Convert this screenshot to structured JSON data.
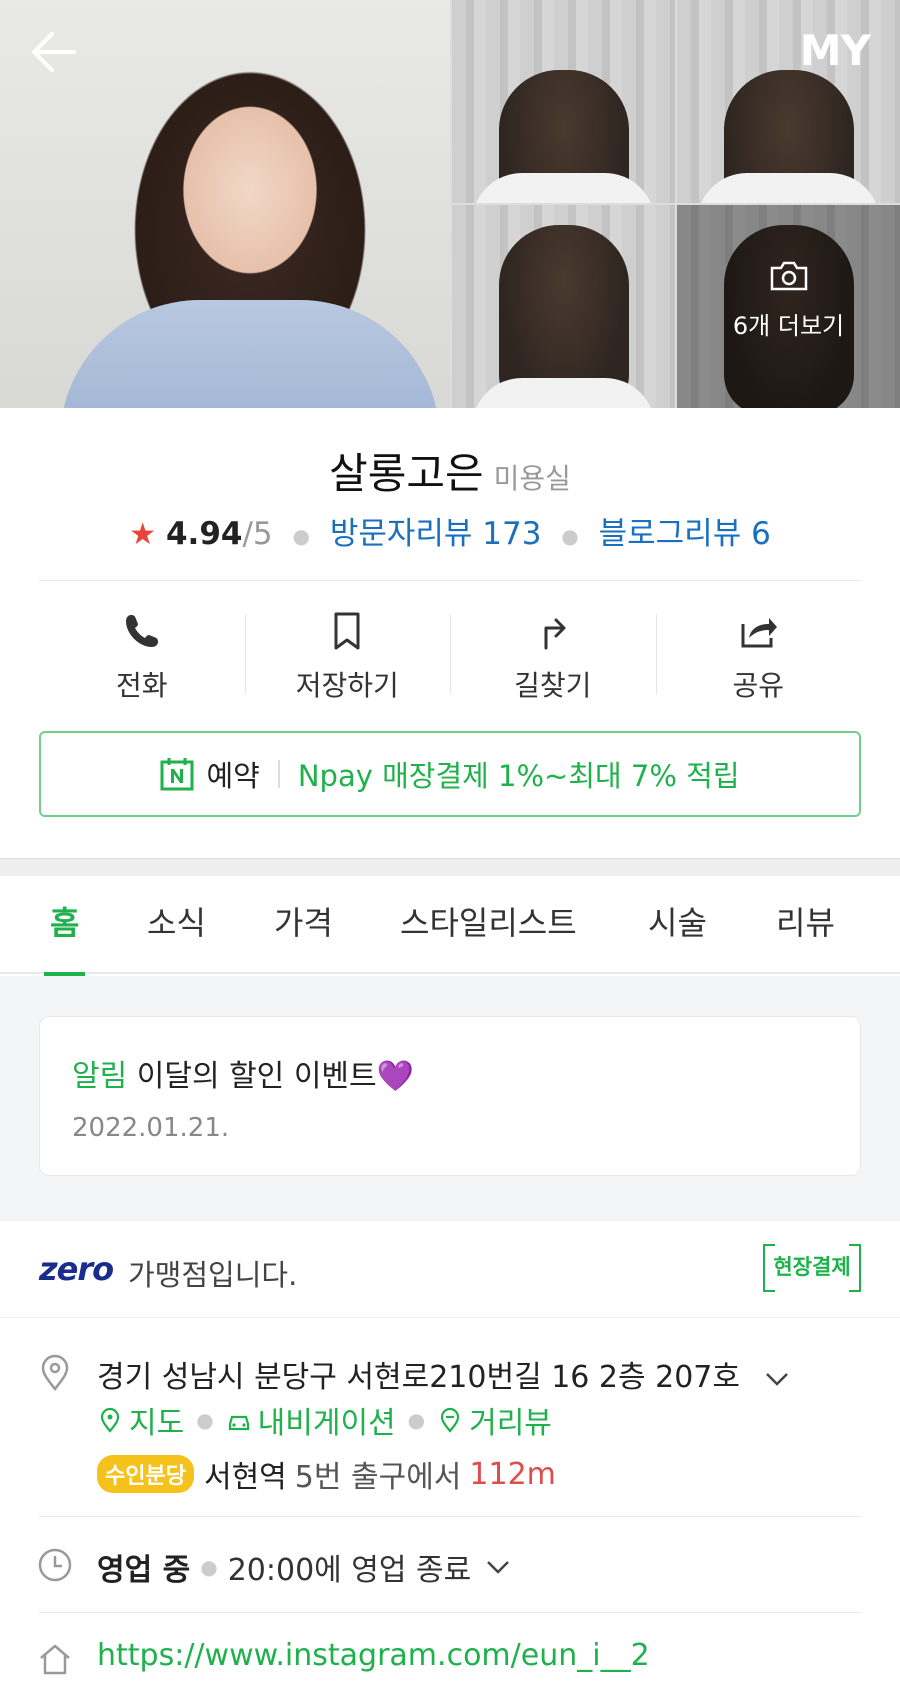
{
  "header": {
    "my_label": "MY"
  },
  "gallery": {
    "more_label": "6개 더보기"
  },
  "shop": {
    "name": "살롱고은",
    "category": "미용실",
    "rating": "4.94",
    "rating_max": "/5",
    "visitor_reviews": "방문자리뷰 173",
    "blog_reviews": "블로그리뷰 6"
  },
  "actions": [
    {
      "label": "전화"
    },
    {
      "label": "저장하기"
    },
    {
      "label": "길찾기"
    },
    {
      "label": "공유"
    }
  ],
  "reserve": {
    "label": "예약",
    "promo": "Npay 매장결제 1%~최대 7% 적립"
  },
  "tabs": [
    {
      "label": "홈"
    },
    {
      "label": "소식"
    },
    {
      "label": "가격"
    },
    {
      "label": "스타일리스트"
    },
    {
      "label": "시술"
    },
    {
      "label": "리뷰"
    }
  ],
  "notice": {
    "tag": "알림",
    "title": "이달의 할인 이벤트💜",
    "date": "2022.01.21."
  },
  "zeropay": {
    "logo": "zero",
    "text": "가맹점입니다.",
    "onsite": "현장결제"
  },
  "address": {
    "text": "경기 성남시 분당구 서현로210번길 16 2층 207호",
    "map": "지도",
    "navigation": "내비게이션",
    "streetview": "거리뷰",
    "line": "수인분당",
    "station": "서현역",
    "exit": "5번 출구에서",
    "distance": "112m"
  },
  "hours": {
    "status": "영업 중",
    "close": "20:00에 영업 종료"
  },
  "website": "https://www.instagram.com/eun_i__2",
  "colors": {
    "accent_green": "#1fb14c",
    "link_blue": "#1b6fbf",
    "star_red": "#e8443a"
  }
}
